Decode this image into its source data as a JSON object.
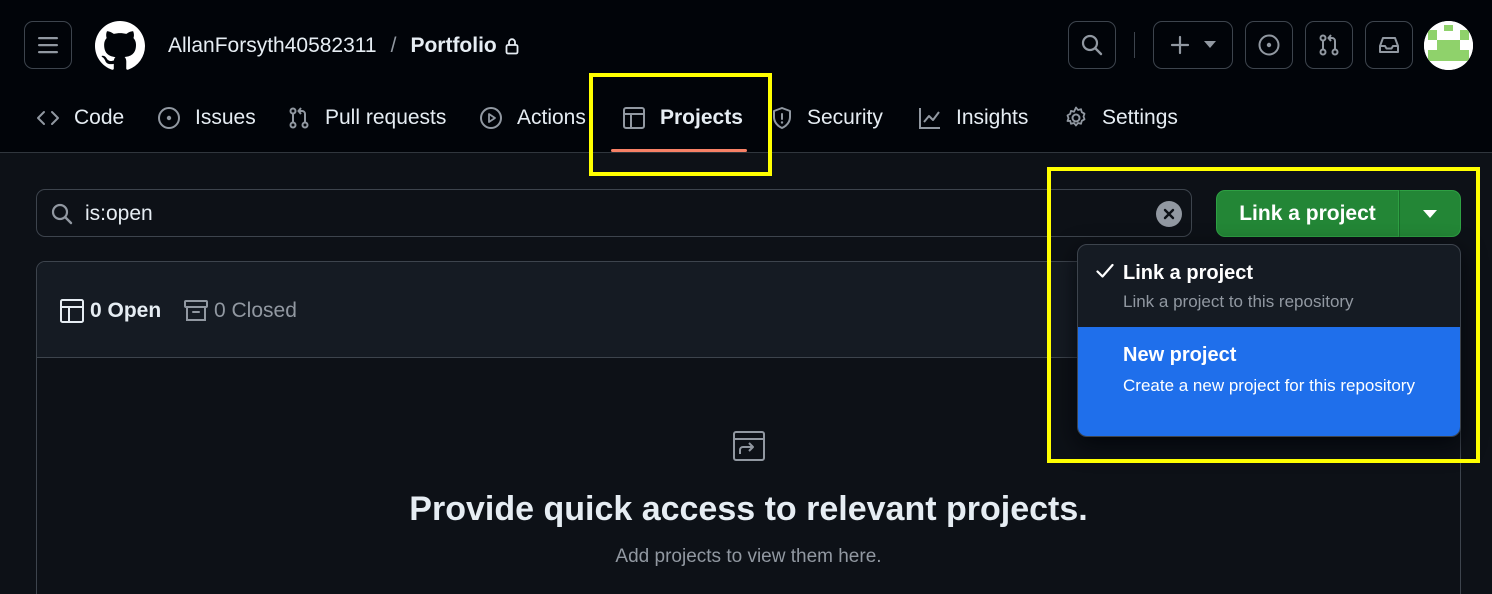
{
  "header": {
    "owner": "AllanForsyth40582311",
    "separator": "/",
    "repo": "Portfolio"
  },
  "tabs": [
    {
      "label": "Code",
      "icon": "code-icon"
    },
    {
      "label": "Issues",
      "icon": "issue-opened-icon"
    },
    {
      "label": "Pull requests",
      "icon": "git-pull-request-icon"
    },
    {
      "label": "Actions",
      "icon": "play-icon"
    },
    {
      "label": "Projects",
      "icon": "table-icon",
      "active": true
    },
    {
      "label": "Security",
      "icon": "shield-icon"
    },
    {
      "label": "Insights",
      "icon": "graph-icon"
    },
    {
      "label": "Settings",
      "icon": "gear-icon"
    }
  ],
  "search": {
    "value": "is:open"
  },
  "link_button": {
    "label": "Link a project"
  },
  "counts": {
    "open": "0 Open",
    "closed": "0 Closed"
  },
  "blank_state": {
    "title": "Provide quick access to relevant projects.",
    "subtitle": "Add projects to view them here."
  },
  "dropdown": {
    "items": [
      {
        "title": "Link a project",
        "description": "Link a project to this repository",
        "selected": true
      },
      {
        "title": "New project",
        "description": "Create a new project for this repository",
        "highlighted": true
      }
    ]
  },
  "colors": {
    "background": "#0d1117",
    "header": "#010409",
    "accent_green": "#238636",
    "highlight_blue": "#1f6feb",
    "active_tab_underline": "#f78166",
    "annotation_yellow": "#ffff00"
  }
}
